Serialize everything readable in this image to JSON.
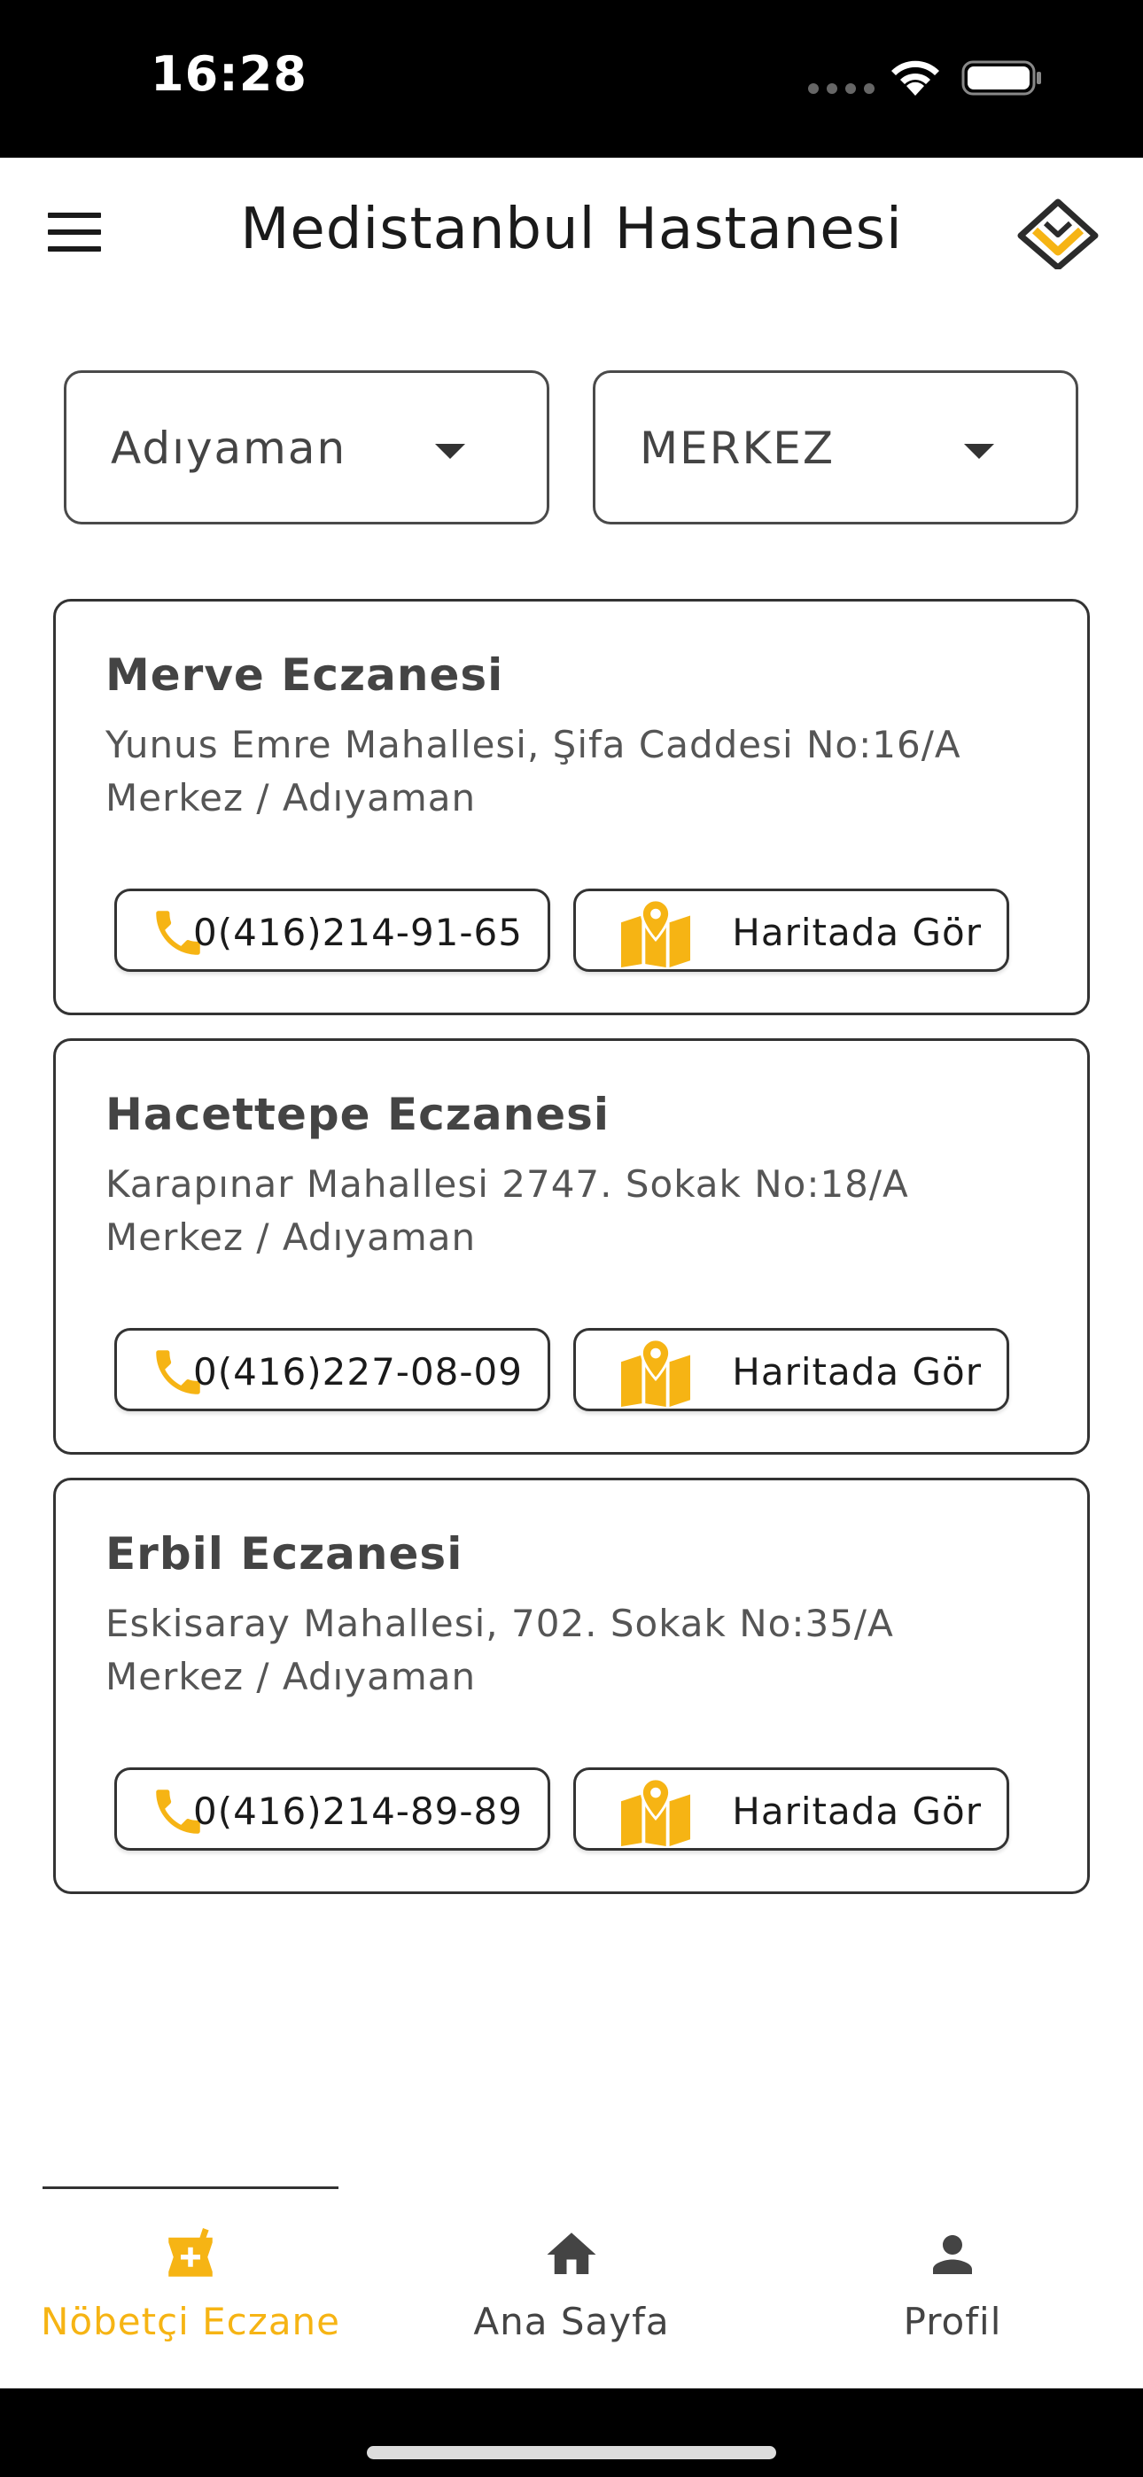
{
  "status_bar": {
    "time": "16:28"
  },
  "header": {
    "title": "Medistanbul Hastanesi",
    "menu_icon": "hamburger-menu-icon",
    "logo_icon": "medistanbul-logo-icon"
  },
  "filters": {
    "city": "Adıyaman",
    "district": "MERKEZ"
  },
  "pharmacies": [
    {
      "name": "Merve Eczanesi",
      "address": "Yunus Emre Mahallesi, Şifa Caddesi No:16/A Merkez / Adıyaman",
      "phone": "0(416)214-91-65",
      "map_label": "Haritada Gör"
    },
    {
      "name": "Hacettepe Eczanesi",
      "address": "Karapınar Mahallesi 2747. Sokak No:18/A Merkez / Adıyaman",
      "phone": "0(416)227-08-09",
      "map_label": "Haritada Gör"
    },
    {
      "name": "Erbil Eczanesi",
      "address": "Eskisaray Mahallesi, 702. Sokak No:35/A Merkez / Adıyaman",
      "phone": "0(416)214-89-89",
      "map_label": "Haritada Gör"
    }
  ],
  "bottom_nav": [
    {
      "label": "Nöbetçi Eczane",
      "icon": "pharmacy-icon",
      "active": true
    },
    {
      "label": "Ana Sayfa",
      "icon": "home-icon",
      "active": false
    },
    {
      "label": "Profil",
      "icon": "person-icon",
      "active": false
    }
  ],
  "colors": {
    "accent": "#f6b414",
    "text": "#333333",
    "border": "#333333"
  }
}
